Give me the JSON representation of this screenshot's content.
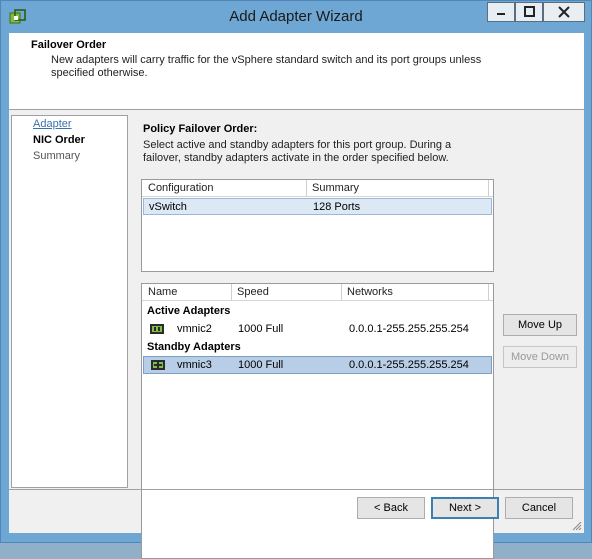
{
  "window": {
    "title": "Add Adapter Wizard"
  },
  "header": {
    "title": "Failover Order",
    "description": "New adapters will carry traffic for the vSphere standard switch and its port groups unless specified otherwise."
  },
  "steps": [
    {
      "label": "Adapter"
    },
    {
      "label": "NIC Order"
    },
    {
      "label": "Summary"
    }
  ],
  "policy": {
    "title": "Policy Failover Order:",
    "description": "Select active and standby adapters for this port group. During a failover, standby adapters activate in the order specified below."
  },
  "switch_table": {
    "columns": [
      "Configuration",
      "Summary"
    ],
    "rows": [
      {
        "configuration": "vSwitch",
        "summary": "128 Ports"
      }
    ]
  },
  "adapter_table": {
    "columns": [
      "Name",
      "Speed",
      "Networks"
    ],
    "active_label": "Active Adapters",
    "standby_label": "Standby Adapters",
    "active": [
      {
        "name": "vmnic2",
        "speed": "1000 Full",
        "networks": "0.0.0.1-255.255.255.254"
      }
    ],
    "standby": [
      {
        "name": "vmnic3",
        "speed": "1000 Full",
        "networks": "0.0.0.1-255.255.255.254"
      }
    ]
  },
  "buttons": {
    "move_up": "Move Up",
    "move_down": "Move Down",
    "back": "< Back",
    "next": "Next >",
    "cancel": "Cancel"
  },
  "colors": {
    "accent": "#3c7fb1",
    "titlebar": "#6fa7d4",
    "selection": "#b8cde6"
  },
  "icons": [
    "vsphere-app-icon",
    "minimize-icon",
    "maximize-icon",
    "close-icon",
    "nic-icon",
    "nic-standby-icon",
    "resize-grip-icon"
  ]
}
